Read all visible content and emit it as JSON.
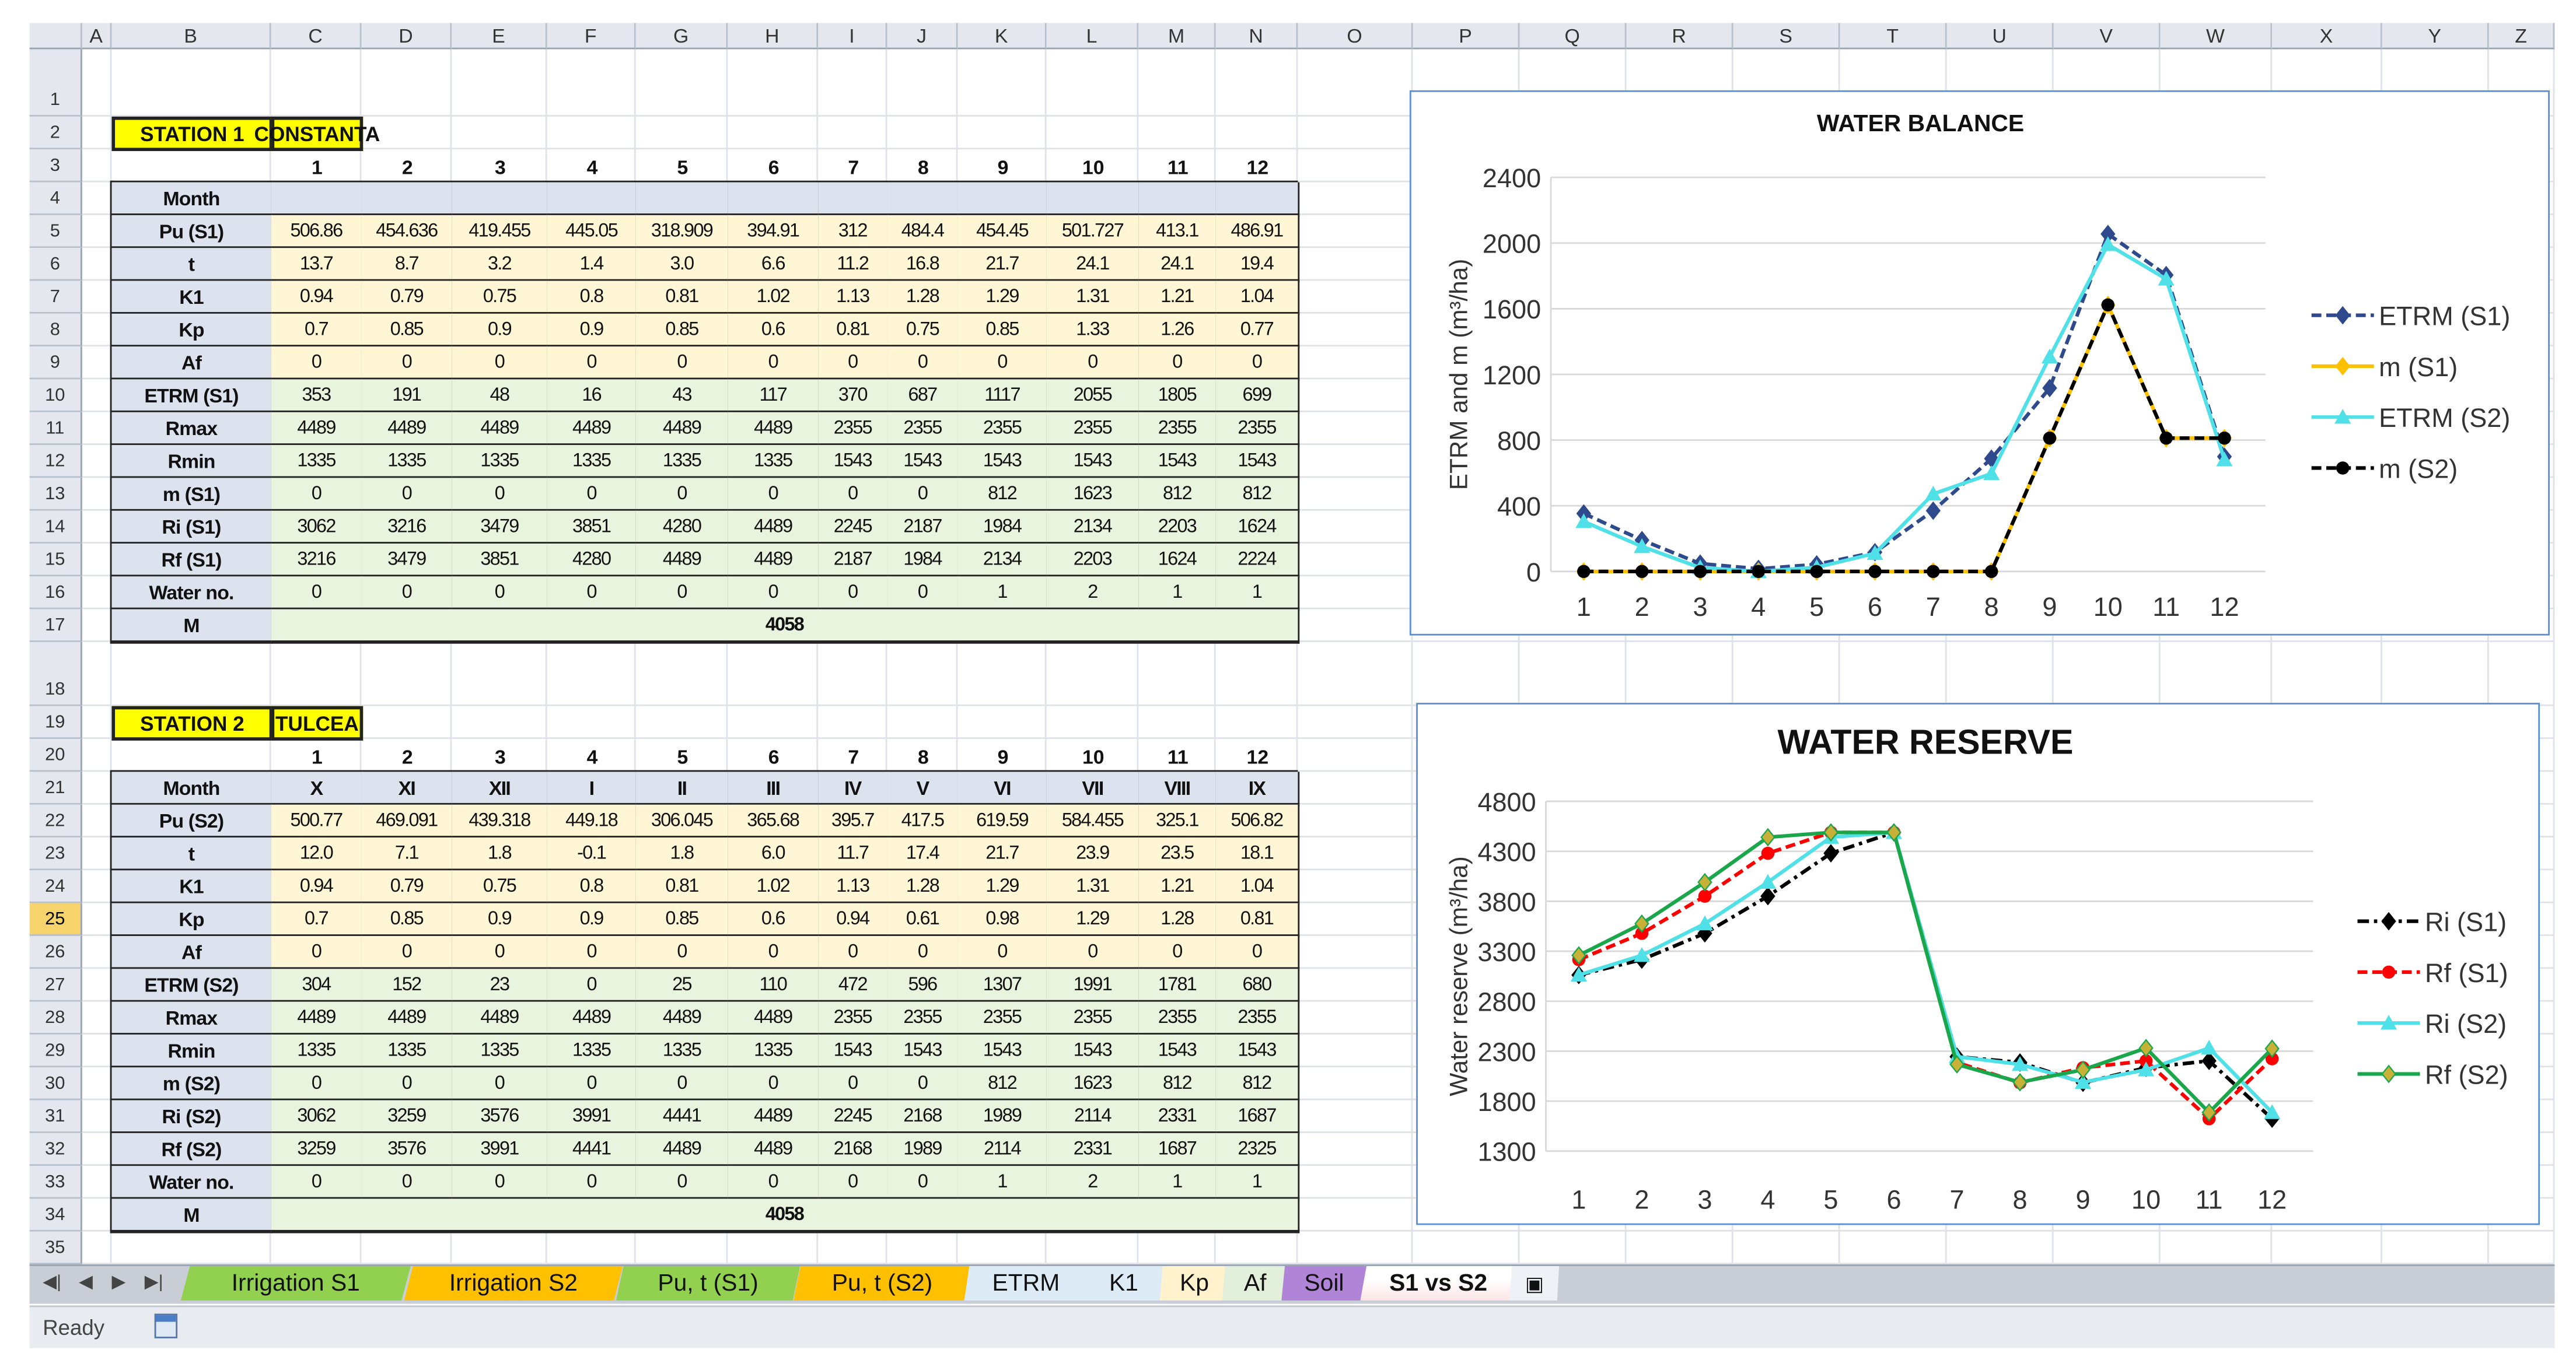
{
  "columns": [
    "A",
    "B",
    "C",
    "D",
    "E",
    "F",
    "G",
    "H",
    "I",
    "J",
    "K",
    "L",
    "M",
    "N",
    "O",
    "P",
    "Q",
    "R",
    "S",
    "T",
    "U",
    "V",
    "W",
    "X",
    "Y",
    "Z"
  ],
  "rows": [
    "1",
    "2",
    "3",
    "4",
    "5",
    "6",
    "7",
    "8",
    "9",
    "10",
    "11",
    "12",
    "13",
    "14",
    "15",
    "16",
    "17",
    "18",
    "19",
    "20",
    "21",
    "22",
    "23",
    "24",
    "25",
    "26",
    "27",
    "28",
    "29",
    "30",
    "31",
    "32",
    "33",
    "34",
    "35"
  ],
  "selected_row": "25",
  "stations": [
    {
      "label": "STATION 1",
      "name": "CONSTANTA",
      "numbers": [
        "1",
        "2",
        "3",
        "4",
        "5",
        "6",
        "7",
        "8",
        "9",
        "10",
        "11",
        "12"
      ],
      "month_label": "Month",
      "months": [
        "",
        "",
        "",
        "",
        "",
        "",
        "",
        "",
        "",
        "",
        "",
        ""
      ],
      "table": [
        {
          "label": "Pu (S1)",
          "band": "yel",
          "values": [
            "506.86",
            "454.636",
            "419.455",
            "445.05",
            "318.909",
            "394.91",
            "312",
            "484.4",
            "454.45",
            "501.727",
            "413.1",
            "486.91"
          ]
        },
        {
          "label": "t",
          "band": "yel",
          "values": [
            "13.7",
            "8.7",
            "3.2",
            "1.4",
            "3.0",
            "6.6",
            "11.2",
            "16.8",
            "21.7",
            "24.1",
            "24.1",
            "19.4"
          ]
        },
        {
          "label": "K1",
          "band": "yel",
          "values": [
            "0.94",
            "0.79",
            "0.75",
            "0.8",
            "0.81",
            "1.02",
            "1.13",
            "1.28",
            "1.29",
            "1.31",
            "1.21",
            "1.04"
          ]
        },
        {
          "label": "Kp",
          "band": "yel",
          "values": [
            "0.7",
            "0.85",
            "0.9",
            "0.9",
            "0.85",
            "0.6",
            "0.81",
            "0.75",
            "0.85",
            "1.33",
            "1.26",
            "0.77"
          ]
        },
        {
          "label": "Af",
          "band": "yel",
          "values": [
            "0",
            "0",
            "0",
            "0",
            "0",
            "0",
            "0",
            "0",
            "0",
            "0",
            "0",
            "0"
          ]
        },
        {
          "label": "ETRM (S1)",
          "band": "grn",
          "values": [
            "353",
            "191",
            "48",
            "16",
            "43",
            "117",
            "370",
            "687",
            "1117",
            "2055",
            "1805",
            "699"
          ]
        },
        {
          "label": "Rmax",
          "band": "grn",
          "values": [
            "4489",
            "4489",
            "4489",
            "4489",
            "4489",
            "4489",
            "2355",
            "2355",
            "2355",
            "2355",
            "2355",
            "2355"
          ]
        },
        {
          "label": "Rmin",
          "band": "grn",
          "values": [
            "1335",
            "1335",
            "1335",
            "1335",
            "1335",
            "1335",
            "1543",
            "1543",
            "1543",
            "1543",
            "1543",
            "1543"
          ]
        },
        {
          "label": "m (S1)",
          "band": "grn",
          "values": [
            "0",
            "0",
            "0",
            "0",
            "0",
            "0",
            "0",
            "0",
            "812",
            "1623",
            "812",
            "812"
          ]
        },
        {
          "label": "Ri (S1)",
          "band": "grn",
          "values": [
            "3062",
            "3216",
            "3479",
            "3851",
            "4280",
            "4489",
            "2245",
            "2187",
            "1984",
            "2134",
            "2203",
            "1624"
          ]
        },
        {
          "label": "Rf (S1)",
          "band": "grn",
          "values": [
            "3216",
            "3479",
            "3851",
            "4280",
            "4489",
            "4489",
            "2187",
            "1984",
            "2134",
            "2203",
            "1624",
            "2224"
          ]
        },
        {
          "label": "Water no.",
          "band": "grn",
          "values": [
            "0",
            "0",
            "0",
            "0",
            "0",
            "0",
            "0",
            "0",
            "1",
            "2",
            "1",
            "1"
          ]
        }
      ],
      "total_label": "M",
      "total": "4058"
    },
    {
      "label": "STATION 2",
      "name": "TULCEA",
      "numbers": [
        "1",
        "2",
        "3",
        "4",
        "5",
        "6",
        "7",
        "8",
        "9",
        "10",
        "11",
        "12"
      ],
      "month_label": "Month",
      "months": [
        "X",
        "XI",
        "XII",
        "I",
        "II",
        "III",
        "IV",
        "V",
        "VI",
        "VII",
        "VIII",
        "IX"
      ],
      "table": [
        {
          "label": "Pu (S2)",
          "band": "yel",
          "values": [
            "500.77",
            "469.091",
            "439.318",
            "449.18",
            "306.045",
            "365.68",
            "395.7",
            "417.5",
            "619.59",
            "584.455",
            "325.1",
            "506.82"
          ]
        },
        {
          "label": "t",
          "band": "yel",
          "values": [
            "12.0",
            "7.1",
            "1.8",
            "-0.1",
            "1.8",
            "6.0",
            "11.7",
            "17.4",
            "21.7",
            "23.9",
            "23.5",
            "18.1"
          ]
        },
        {
          "label": "K1",
          "band": "yel",
          "values": [
            "0.94",
            "0.79",
            "0.75",
            "0.8",
            "0.81",
            "1.02",
            "1.13",
            "1.28",
            "1.29",
            "1.31",
            "1.21",
            "1.04"
          ]
        },
        {
          "label": "Kp",
          "band": "yel",
          "values": [
            "0.7",
            "0.85",
            "0.9",
            "0.9",
            "0.85",
            "0.6",
            "0.94",
            "0.61",
            "0.98",
            "1.29",
            "1.28",
            "0.81"
          ]
        },
        {
          "label": "Af",
          "band": "yel",
          "values": [
            "0",
            "0",
            "0",
            "0",
            "0",
            "0",
            "0",
            "0",
            "0",
            "0",
            "0",
            "0"
          ]
        },
        {
          "label": "ETRM (S2)",
          "band": "grn",
          "values": [
            "304",
            "152",
            "23",
            "0",
            "25",
            "110",
            "472",
            "596",
            "1307",
            "1991",
            "1781",
            "680"
          ]
        },
        {
          "label": "Rmax",
          "band": "grn",
          "values": [
            "4489",
            "4489",
            "4489",
            "4489",
            "4489",
            "4489",
            "2355",
            "2355",
            "2355",
            "2355",
            "2355",
            "2355"
          ]
        },
        {
          "label": "Rmin",
          "band": "grn",
          "values": [
            "1335",
            "1335",
            "1335",
            "1335",
            "1335",
            "1335",
            "1543",
            "1543",
            "1543",
            "1543",
            "1543",
            "1543"
          ]
        },
        {
          "label": "m (S2)",
          "band": "grn",
          "values": [
            "0",
            "0",
            "0",
            "0",
            "0",
            "0",
            "0",
            "0",
            "812",
            "1623",
            "812",
            "812"
          ]
        },
        {
          "label": "Ri (S2)",
          "band": "grn",
          "values": [
            "3062",
            "3259",
            "3576",
            "3991",
            "4441",
            "4489",
            "2245",
            "2168",
            "1989",
            "2114",
            "2331",
            "1687"
          ]
        },
        {
          "label": "Rf (S2)",
          "band": "grn",
          "values": [
            "3259",
            "3576",
            "3991",
            "4441",
            "4489",
            "4489",
            "2168",
            "1989",
            "2114",
            "2331",
            "1687",
            "2325"
          ]
        },
        {
          "label": "Water no.",
          "band": "grn",
          "values": [
            "0",
            "0",
            "0",
            "0",
            "0",
            "0",
            "0",
            "0",
            "1",
            "2",
            "1",
            "1"
          ]
        }
      ],
      "total_label": "M",
      "total": "4058"
    }
  ],
  "chart_data": [
    {
      "type": "line",
      "title": "WATER BALANCE",
      "xlabel": "",
      "ylabel": "ETRM and m (m³/ha)",
      "x": [
        1,
        2,
        3,
        4,
        5,
        6,
        7,
        8,
        9,
        10,
        11,
        12
      ],
      "xticks": [
        "1",
        "2",
        "3",
        "4",
        "5",
        "6",
        "7",
        "8",
        "9",
        "10",
        "11",
        "12"
      ],
      "ylim": [
        0,
        2400
      ],
      "yticks": [
        "0",
        "400",
        "800",
        "1200",
        "1600",
        "2000",
        "2400"
      ],
      "grid": true,
      "legend": "right",
      "series": [
        {
          "name": "ETRM (S1)",
          "color": "#2e4a8c",
          "dash": "dashed",
          "marker": "diamond",
          "values": [
            353,
            191,
            48,
            16,
            43,
            117,
            370,
            687,
            1117,
            2055,
            1805,
            699
          ]
        },
        {
          "name": "m (S1)",
          "color": "#ffc000",
          "dash": "solid",
          "marker": "diamond",
          "values": [
            0,
            0,
            0,
            0,
            0,
            0,
            0,
            0,
            812,
            1623,
            812,
            812
          ]
        },
        {
          "name": "ETRM (S2)",
          "color": "#4fe0e8",
          "dash": "solid",
          "marker": "triangle",
          "values": [
            304,
            152,
            23,
            0,
            25,
            110,
            472,
            596,
            1307,
            1991,
            1781,
            680
          ]
        },
        {
          "name": "m (S2)",
          "color": "#000000",
          "dash": "dashed",
          "marker": "circle",
          "values": [
            0,
            0,
            0,
            0,
            0,
            0,
            0,
            0,
            812,
            1623,
            812,
            812
          ]
        }
      ]
    },
    {
      "type": "line",
      "title": "WATER RESERVE",
      "xlabel": "",
      "ylabel": "Water reserve (m³/ha)",
      "x": [
        1,
        2,
        3,
        4,
        5,
        6,
        7,
        8,
        9,
        10,
        11,
        12
      ],
      "xticks": [
        "1",
        "2",
        "3",
        "4",
        "5",
        "6",
        "7",
        "8",
        "9",
        "10",
        "11",
        "12"
      ],
      "ylim": [
        1300,
        4800
      ],
      "yticks": [
        "1300",
        "1800",
        "2300",
        "2800",
        "3300",
        "3800",
        "4300",
        "4800"
      ],
      "grid": true,
      "legend": "right",
      "series": [
        {
          "name": "Ri (S1)",
          "color": "#000000",
          "dash": "dashdot",
          "marker": "diamond",
          "values": [
            3062,
            3216,
            3479,
            3851,
            4280,
            4489,
            2245,
            2187,
            1984,
            2134,
            2203,
            1624
          ]
        },
        {
          "name": "Rf (S1)",
          "color": "#ff0000",
          "dash": "dashed",
          "marker": "circle",
          "values": [
            3216,
            3479,
            3851,
            4280,
            4489,
            4489,
            2187,
            1984,
            2134,
            2203,
            1624,
            2224
          ]
        },
        {
          "name": "Ri (S2)",
          "color": "#4fe0e8",
          "dash": "solid",
          "marker": "triangle",
          "values": [
            3062,
            3259,
            3576,
            3991,
            4441,
            4489,
            2245,
            2168,
            1989,
            2114,
            2331,
            1687
          ]
        },
        {
          "name": "Rf (S2)",
          "color": "#1aa64a",
          "dash": "solid",
          "marker": "diamond",
          "values": [
            3259,
            3576,
            3991,
            4441,
            4489,
            4489,
            2168,
            1989,
            2114,
            2331,
            1687,
            2325
          ]
        }
      ]
    }
  ],
  "tabs": [
    {
      "label": "Irrigation S1",
      "color": "#92d050"
    },
    {
      "label": "Irrigation S2",
      "color": "#ffc000"
    },
    {
      "label": "Pu, t (S1)",
      "color": "#92d050"
    },
    {
      "label": "Pu, t (S2)",
      "color": "#ffc000"
    },
    {
      "label": "ETRM",
      "color": "#ddebf7"
    },
    {
      "label": "K1",
      "color": "#ddebf7"
    },
    {
      "label": "Kp",
      "color": "#fff2cc"
    },
    {
      "label": "Af",
      "color": "#e2efda"
    },
    {
      "label": "Soil",
      "color": "#b084d6"
    },
    {
      "label": "S1 vs S2",
      "color": "#fce4e4",
      "active": true
    }
  ],
  "status": {
    "text": "Ready"
  }
}
